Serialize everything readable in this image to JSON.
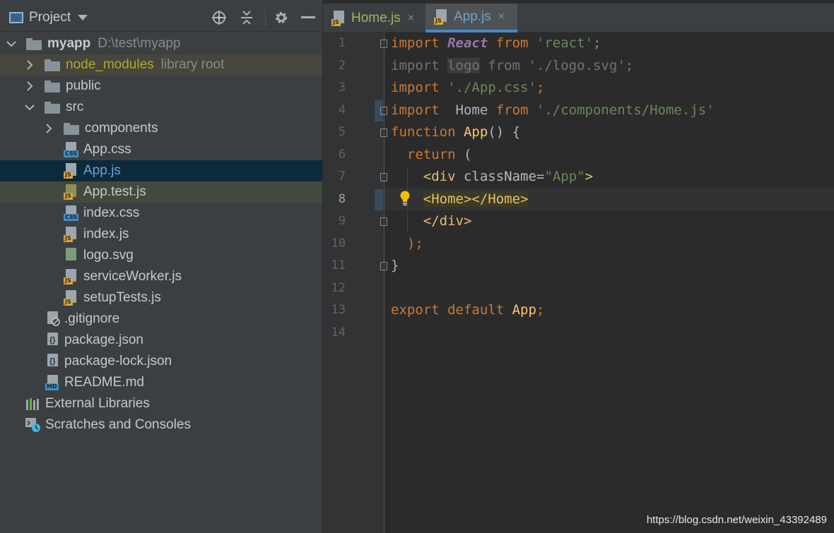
{
  "project": {
    "title": "Project",
    "root": {
      "name": "myapp",
      "path": "D:\\test\\myapp"
    },
    "items": [
      {
        "label": "node_modules",
        "suffix": "library root"
      },
      {
        "label": "public"
      },
      {
        "label": "src"
      },
      {
        "label": "components"
      },
      {
        "label": "App.css",
        "tag": "CSS"
      },
      {
        "label": "App.js",
        "tag": "JS"
      },
      {
        "label": "App.test.js",
        "tag": "JS"
      },
      {
        "label": "index.css",
        "tag": "CSS"
      },
      {
        "label": "index.js",
        "tag": "JS"
      },
      {
        "label": "logo.svg"
      },
      {
        "label": "serviceWorker.js",
        "tag": "JS"
      },
      {
        "label": "setupTests.js",
        "tag": "JS"
      },
      {
        "label": ".gitignore"
      },
      {
        "label": "package.json"
      },
      {
        "label": "package-lock.json"
      },
      {
        "label": "README.md",
        "tag": "MD"
      },
      {
        "label": "External Libraries"
      },
      {
        "label": "Scratches and Consoles"
      }
    ]
  },
  "editor": {
    "tabs": [
      {
        "label": "Home.js",
        "close": "×"
      },
      {
        "label": "App.js",
        "close": "×"
      }
    ],
    "active_tab": "App.js",
    "line_numbers": [
      "1",
      "2",
      "3",
      "4",
      "5",
      "6",
      "7",
      "8",
      "9",
      "10",
      "11",
      "12",
      "13",
      "14"
    ],
    "current_line": 8,
    "code": {
      "l1": {
        "a": "import ",
        "b": "React",
        "c": " from ",
        "d": "'react'",
        "e": ";"
      },
      "l2": {
        "a": "import ",
        "b": "logo",
        "c": " from ",
        "d": "'./logo.svg'",
        "e": ";"
      },
      "l3": {
        "a": "import ",
        "b": "'./App.css'",
        "c": ";"
      },
      "l4": {
        "a": "import ",
        "b": " Home ",
        "c": "from ",
        "d": "'./components/Home.js'"
      },
      "l5": {
        "a": "function ",
        "b": "App",
        "c": "() {"
      },
      "l6": {
        "a": "  return ",
        "b": "("
      },
      "l7": {
        "a": "    ",
        "b": "<div ",
        "c": "className",
        "d": "=",
        "e": "\"App\"",
        "f": ">"
      },
      "l8": {
        "a": "    ",
        "b": "<Home></Home>"
      },
      "l9": {
        "a": "    ",
        "b": "</div>"
      },
      "l10": {
        "a": "  );"
      },
      "l11": {
        "a": "}"
      },
      "l13": {
        "a": "export default ",
        "b": "App",
        "c": ";"
      }
    }
  },
  "watermark": "https://blog.csdn.net/weixin_43392489",
  "colors": {
    "keyword": "#cc7832",
    "string": "#6a8759",
    "function": "#ffc66d",
    "tag": "#e8bf6a",
    "selection": "#0d293e",
    "accent": "#4a88c7"
  }
}
